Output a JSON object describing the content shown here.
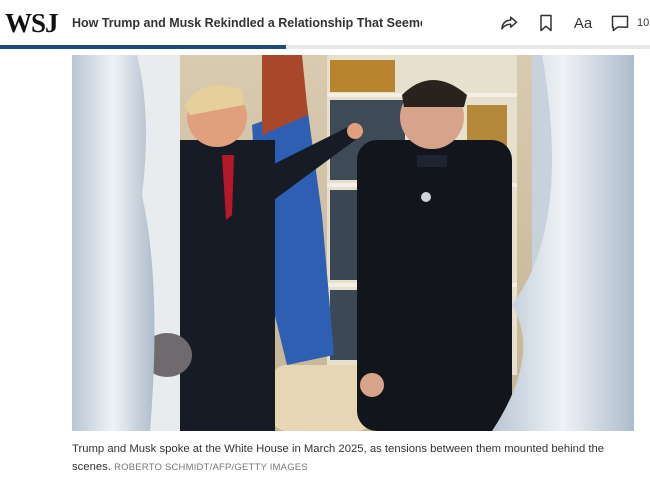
{
  "header": {
    "logo": "WSJ",
    "headline": "How Trump and Musk Rekindled a Relationship That Seemed ...",
    "icons": {
      "share": "share-icon",
      "bookmark": "bookmark-icon",
      "text_size": "Aa",
      "comments": "comment-icon"
    },
    "comment_count": "10",
    "reading_progress": 0.44,
    "progress_color": "#1a4d7a"
  },
  "article": {
    "photo_alt": "photo",
    "caption": "Trump and Musk spoke at the White House in March 2025, as tensions between them mounted behind the scenes.",
    "credit": "ROBERTO SCHMIDT/AFP/GETTY IMAGES"
  }
}
